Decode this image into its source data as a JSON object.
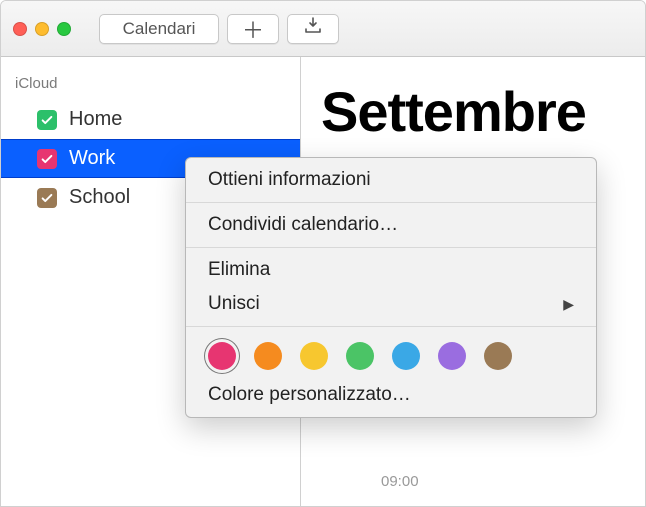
{
  "toolbar": {
    "calendars_label": "Calendari"
  },
  "sidebar": {
    "section": "iCloud",
    "items": [
      {
        "label": "Home",
        "color": "#2cc06a",
        "selected": false
      },
      {
        "label": "Work",
        "color": "#e73571",
        "selected": true
      },
      {
        "label": "School",
        "color": "#9a7a55",
        "selected": false
      }
    ]
  },
  "main": {
    "month": "Settembre",
    "time_label": "09:00"
  },
  "context_menu": {
    "get_info": "Ottieni informazioni",
    "share": "Condividi calendario…",
    "delete": "Elimina",
    "merge": "Unisci",
    "custom_color": "Colore personalizzato…",
    "swatches": [
      {
        "color": "#e73571",
        "selected": true
      },
      {
        "color": "#f58b1f",
        "selected": false
      },
      {
        "color": "#f7c72f",
        "selected": false
      },
      {
        "color": "#4bc466",
        "selected": false
      },
      {
        "color": "#3aa8e6",
        "selected": false
      },
      {
        "color": "#9a6de0",
        "selected": false
      },
      {
        "color": "#9a7a55",
        "selected": false
      }
    ]
  }
}
